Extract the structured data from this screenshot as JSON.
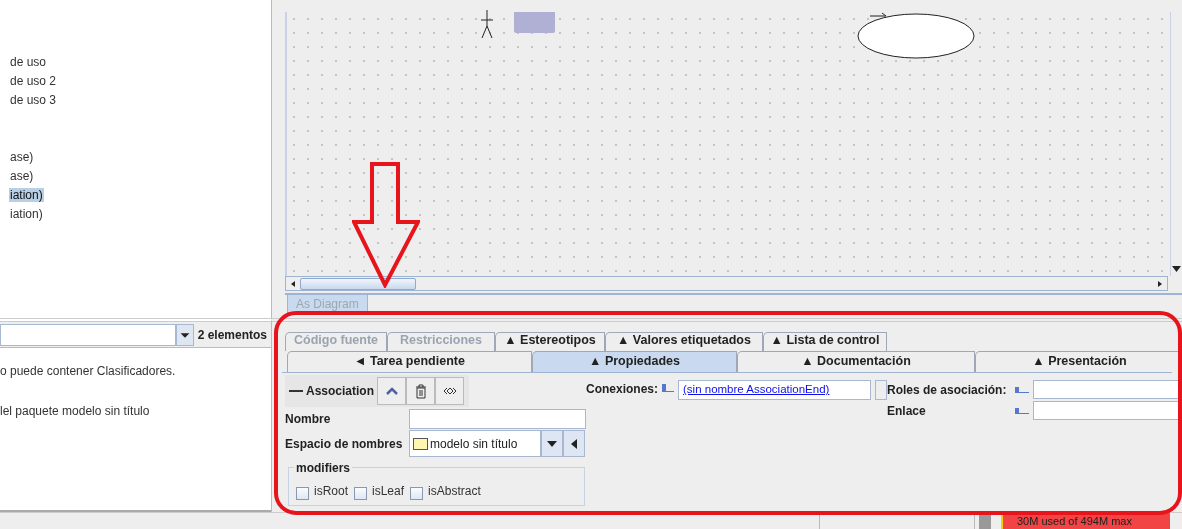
{
  "explorer": {
    "groups": [
      [
        {
          "label": "de uso",
          "selected": false
        },
        {
          "label": "de uso 2",
          "selected": false
        },
        {
          "label": "de uso 3",
          "selected": false
        }
      ],
      [
        {
          "label": "ase)",
          "selected": false
        },
        {
          "label": "ase)",
          "selected": false
        },
        {
          "label": "iation)",
          "selected": true
        },
        {
          "label": "iation)",
          "selected": false
        }
      ]
    ]
  },
  "diagram": {
    "tab": "As Diagram"
  },
  "todo_panel": {
    "count": "2 elementos",
    "lines": [
      "o puede contener Clasificadores.",
      "lel paquete modelo sin título"
    ]
  },
  "properties": {
    "tab_rows": [
      [
        {
          "label": "Código fuente",
          "disabled": true,
          "selected": false
        },
        {
          "label": "Restricciones",
          "disabled": true,
          "selected": false
        },
        {
          "label": "▲ Estereotipos",
          "disabled": false,
          "selected": false
        },
        {
          "label": "▲ Valores etiquetados",
          "disabled": false,
          "selected": false
        },
        {
          "label": "▲ Lista de control",
          "disabled": false,
          "selected": false
        }
      ],
      [
        {
          "label": "◄ Tarea pendiente",
          "disabled": false,
          "selected": false
        },
        {
          "label": "▲ Propiedades",
          "disabled": false,
          "selected": true
        },
        {
          "label": "▲ Documentación",
          "disabled": false,
          "selected": false
        },
        {
          "label": "▲ Presentación",
          "disabled": false,
          "selected": false
        }
      ]
    ],
    "element_type": "Association",
    "name_label": "Nombre",
    "namespace_label": "Espacio de nombres",
    "namespace_value": "modelo sin título",
    "modifiers_title": "modifiers",
    "modifiers": [
      {
        "label": "isRoot",
        "checked": false
      },
      {
        "label": "isLeaf",
        "checked": false
      },
      {
        "label": "isAbstract",
        "checked": false
      }
    ],
    "connections_label": "Conexiones:",
    "connection_value": "(sin nombre AssociationEnd)",
    "roles_label": "Roles de asociación:",
    "link_label": "Enlace"
  },
  "status_bar": {
    "memory": "30M used of 494M max"
  }
}
